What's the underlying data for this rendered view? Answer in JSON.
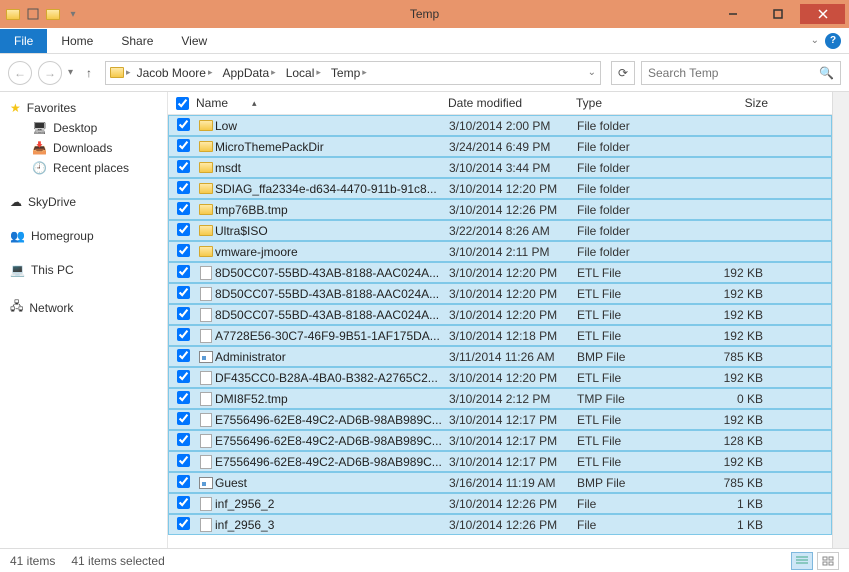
{
  "window": {
    "title": "Temp"
  },
  "ribbon": {
    "file": "File",
    "home": "Home",
    "share": "Share",
    "view": "View"
  },
  "breadcrumbs": [
    "Jacob Moore",
    "AppData",
    "Local",
    "Temp"
  ],
  "search": {
    "placeholder": "Search Temp"
  },
  "sidebar": {
    "favorites": {
      "label": "Favorites",
      "items": [
        "Desktop",
        "Downloads",
        "Recent places"
      ]
    },
    "skydrive": "SkyDrive",
    "homegroup": "Homegroup",
    "thispc": "This PC",
    "network": "Network"
  },
  "columns": {
    "name": "Name",
    "date": "Date modified",
    "type": "Type",
    "size": "Size"
  },
  "files": [
    {
      "icon": "folder",
      "name": "Low",
      "date": "3/10/2014 2:00 PM",
      "type": "File folder",
      "size": ""
    },
    {
      "icon": "folder",
      "name": "MicroThemePackDir",
      "date": "3/24/2014 6:49 PM",
      "type": "File folder",
      "size": ""
    },
    {
      "icon": "folder",
      "name": "msdt",
      "date": "3/10/2014 3:44 PM",
      "type": "File folder",
      "size": ""
    },
    {
      "icon": "folder",
      "name": "SDIAG_ffa2334e-d634-4470-911b-91c8...",
      "date": "3/10/2014 12:20 PM",
      "type": "File folder",
      "size": ""
    },
    {
      "icon": "folder",
      "name": "tmp76BB.tmp",
      "date": "3/10/2014 12:26 PM",
      "type": "File folder",
      "size": ""
    },
    {
      "icon": "folder",
      "name": "Ultra$ISO",
      "date": "3/22/2014 8:26 AM",
      "type": "File folder",
      "size": ""
    },
    {
      "icon": "folder",
      "name": "vmware-jmoore",
      "date": "3/10/2014 2:11 PM",
      "type": "File folder",
      "size": ""
    },
    {
      "icon": "file",
      "name": "8D50CC07-55BD-43AB-8188-AAC024A...",
      "date": "3/10/2014 12:20 PM",
      "type": "ETL File",
      "size": "192 KB"
    },
    {
      "icon": "file",
      "name": "8D50CC07-55BD-43AB-8188-AAC024A...",
      "date": "3/10/2014 12:20 PM",
      "type": "ETL File",
      "size": "192 KB"
    },
    {
      "icon": "file",
      "name": "8D50CC07-55BD-43AB-8188-AAC024A...",
      "date": "3/10/2014 12:20 PM",
      "type": "ETL File",
      "size": "192 KB"
    },
    {
      "icon": "file",
      "name": "A7728E56-30C7-46F9-9B51-1AF175DA...",
      "date": "3/10/2014 12:18 PM",
      "type": "ETL File",
      "size": "192 KB"
    },
    {
      "icon": "bmp",
      "name": "Administrator",
      "date": "3/11/2014 11:26 AM",
      "type": "BMP File",
      "size": "785 KB"
    },
    {
      "icon": "file",
      "name": "DF435CC0-B28A-4BA0-B382-A2765C2...",
      "date": "3/10/2014 12:20 PM",
      "type": "ETL File",
      "size": "192 KB"
    },
    {
      "icon": "file",
      "name": "DMI8F52.tmp",
      "date": "3/10/2014 2:12 PM",
      "type": "TMP File",
      "size": "0 KB"
    },
    {
      "icon": "file",
      "name": "E7556496-62E8-49C2-AD6B-98AB989C...",
      "date": "3/10/2014 12:17 PM",
      "type": "ETL File",
      "size": "192 KB"
    },
    {
      "icon": "file",
      "name": "E7556496-62E8-49C2-AD6B-98AB989C...",
      "date": "3/10/2014 12:17 PM",
      "type": "ETL File",
      "size": "128 KB"
    },
    {
      "icon": "file",
      "name": "E7556496-62E8-49C2-AD6B-98AB989C...",
      "date": "3/10/2014 12:17 PM",
      "type": "ETL File",
      "size": "192 KB"
    },
    {
      "icon": "bmp",
      "name": "Guest",
      "date": "3/16/2014 11:19 AM",
      "type": "BMP File",
      "size": "785 KB"
    },
    {
      "icon": "file",
      "name": "inf_2956_2",
      "date": "3/10/2014 12:26 PM",
      "type": "File",
      "size": "1 KB"
    },
    {
      "icon": "file",
      "name": "inf_2956_3",
      "date": "3/10/2014 12:26 PM",
      "type": "File",
      "size": "1 KB"
    }
  ],
  "status": {
    "items": "41 items",
    "selected": "41 items selected"
  }
}
